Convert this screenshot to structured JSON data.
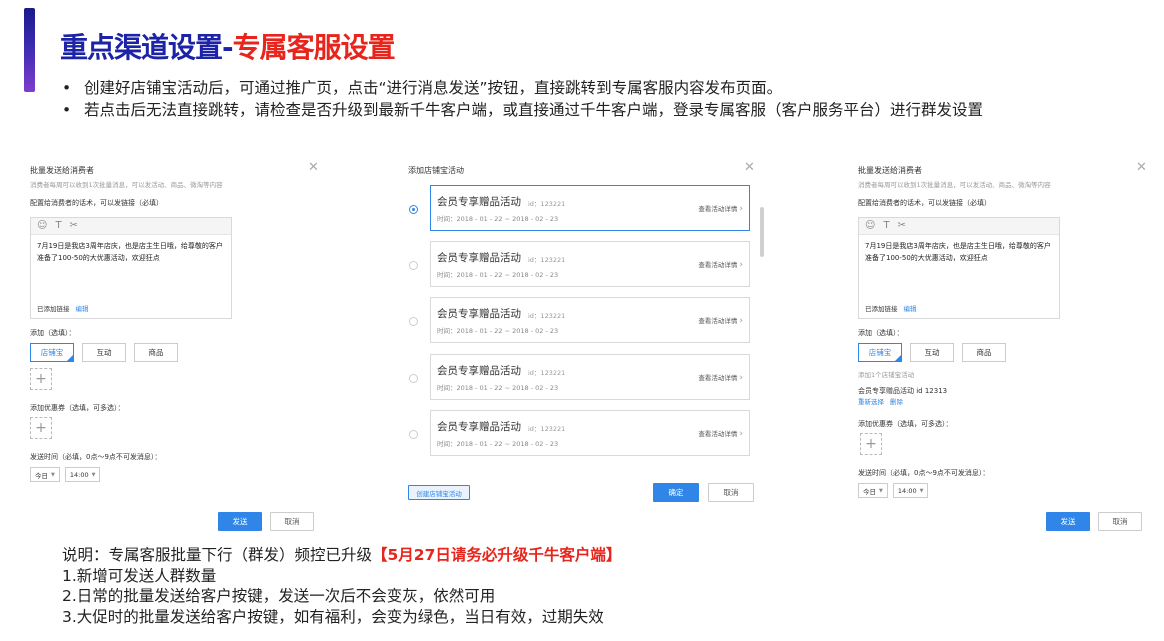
{
  "header": {
    "title_part1": "重点渠道设置-",
    "title_part2": "专属客服设置",
    "bullet_symbol": "•",
    "bullets": [
      "创建好店铺宝活动后，可通过推广页，点击“进行消息发送”按钮，直接跳转到专属客服内容发布页面。",
      "若点击后无法直接跳转，请检查是否升级到最新千牛客户端，或直接通过千牛客户端，登录专属客服（客户服务平台）进行群发设置"
    ]
  },
  "left_panel": {
    "title": "批量发送给消费者",
    "subtitle": "消费者每周可以收到1次批量消息，可以发活动、商品、微淘等内容",
    "editor_label": "配置给消费者的话术，可以发链接（必填）",
    "editor_icons": [
      "☺",
      "T",
      "🔗"
    ],
    "editor_text_line1": "7月19日是我店3周年店庆，也是店主生日哦，给尊敬的客户",
    "editor_text_line2": "准备了100-50的大优惠活动，欢迎狂点",
    "link_added": "已添加链接",
    "edit_link": "编辑",
    "add_label": "添加（选填）：",
    "tags": [
      "店铺宝",
      "互动",
      "商品"
    ],
    "coupon_label": "添加优惠券（选填，可多选）：",
    "send_time_label": "发送时间（必填，0点～9点不可发消息）：",
    "date_value": "今日",
    "time_value": "14:00",
    "send_button": "发送",
    "cancel_button": "取消"
  },
  "middle_panel": {
    "title": "添加店铺宝活动",
    "activities": [
      {
        "name": "会员专享赠品活动",
        "id": "id：123221",
        "time": "时间：2018 - 01 - 22 ~ 2018 - 02 - 23",
        "detail": "查看活动详情",
        "selected": true
      },
      {
        "name": "会员专享赠品活动",
        "id": "id：123221",
        "time": "时间：2018 - 01 - 22 ~ 2018 - 02 - 23",
        "detail": "查看活动详情",
        "selected": false
      },
      {
        "name": "会员专享赠品活动",
        "id": "id：123221",
        "time": "时间：2018 - 01 - 22 ~ 2018 - 02 - 23",
        "detail": "查看活动详情",
        "selected": false
      },
      {
        "name": "会员专享赠品活动",
        "id": "id：123221",
        "time": "时间：2018 - 01 - 22 ~ 2018 - 02 - 23",
        "detail": "查看活动详情",
        "selected": false
      },
      {
        "name": "会员专享赠品活动",
        "id": "id：123221",
        "time": "时间：2018 - 01 - 22 ~ 2018 - 02 - 23",
        "detail": "查看活动详情",
        "selected": false
      }
    ],
    "create_button": "创建店铺宝活动",
    "confirm_button": "确定",
    "cancel_button": "取消"
  },
  "right_panel": {
    "title": "批量发送给消费者",
    "subtitle": "消费者每周可以收到1次批量消息，可以发活动、商品、微淘等内容",
    "editor_label": "配置给消费者的话术，可以发链接（必填）",
    "editor_icons": [
      "☺",
      "T",
      "🔗"
    ],
    "editor_text_line1": "7月19日是我店3周年店庆，也是店主生日哦，给尊敬的客户",
    "editor_text_line2": "准备了100-50的大优惠活动，欢迎狂点",
    "link_added": "已添加链接",
    "edit_link": "编辑",
    "add_label": "添加（选填）：",
    "tags": [
      "店铺宝",
      "互动",
      "商品"
    ],
    "added_hint": "添加1个店铺宝活动",
    "picked_activity": "会员专享赠品活动 id 12313",
    "reselect": "重新选择",
    "delete": "删除",
    "coupon_label": "添加优惠券（选填，可多选）：",
    "send_time_label": "发送时间（必填，0点～9点不可发消息）：",
    "date_value": "今日",
    "time_value": "14:00",
    "send_button": "发送",
    "cancel_button": "取消"
  },
  "notes": {
    "intro": "说明：专属客服批量下行（群发）频控已升级",
    "highlight": "【5月27日请务必升级千牛客户端】",
    "items": [
      "1.新增可发送人群数量",
      "2.日常的批量发送给客户按键，发送一次后不会变灰，依然可用",
      "3.大促时的批量发送给客户按键，如有福利，会变为绿色，当日有效，过期失效"
    ]
  }
}
